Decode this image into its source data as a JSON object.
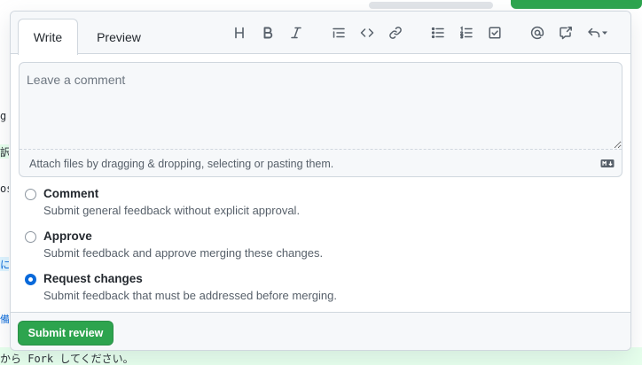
{
  "tabs": {
    "write": "Write",
    "preview": "Preview"
  },
  "toolbar": {
    "icons": [
      "heading-icon",
      "bold-icon",
      "italic-icon",
      "quote-icon",
      "code-icon",
      "link-icon",
      "bulleted-list-icon",
      "numbered-list-icon",
      "task-list-icon",
      "mention-icon",
      "cross-reference-icon",
      "saved-replies-icon"
    ]
  },
  "editor": {
    "placeholder": "Leave a comment",
    "value": "",
    "attach_hint": "Attach files by dragging & dropping, selecting or pasting them."
  },
  "review_options": [
    {
      "title": "Comment",
      "description": "Submit general feedback without explicit approval.",
      "checked": false
    },
    {
      "title": "Approve",
      "description": "Submit feedback and approve merging these changes.",
      "checked": false
    },
    {
      "title": "Request changes",
      "description": "Submit feedback that must be addressed before merging.",
      "checked": true
    }
  ],
  "footer": {
    "submit_label": "Submit review"
  },
  "background": {
    "fragments": [
      "g:",
      "訳",
      "os",
      "に遠",
      "備"
    ],
    "bottom_text": "から Fork してください。"
  },
  "colors": {
    "accent_green": "#2da44e",
    "accent_blue": "#0969da"
  }
}
